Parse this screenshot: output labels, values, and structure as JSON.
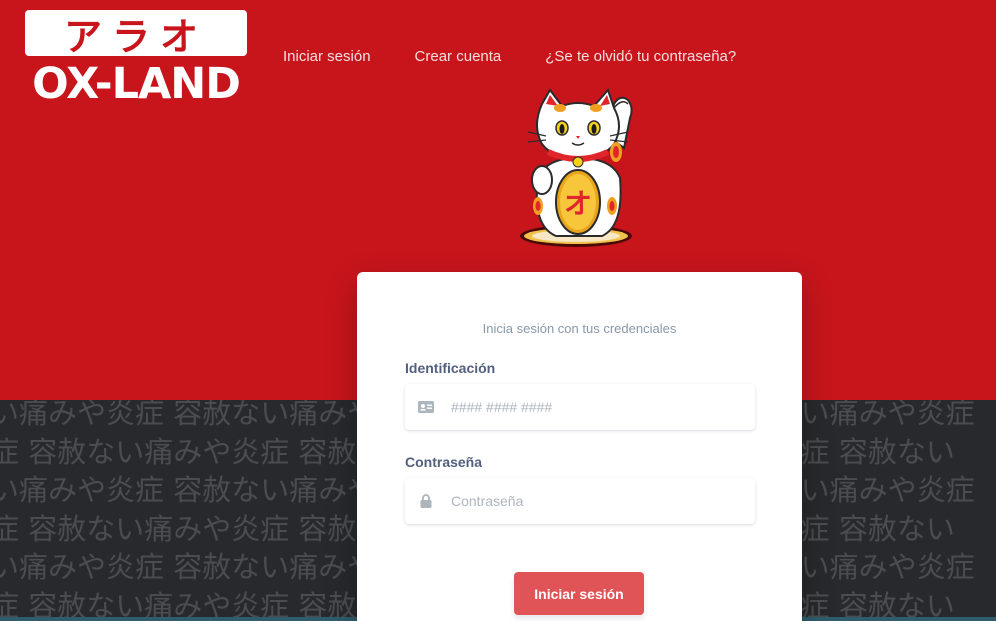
{
  "brand": {
    "logo_kana": "アラオ",
    "logo_word": "OX-LAND"
  },
  "nav": {
    "items": [
      {
        "label": "Iniciar sesión"
      },
      {
        "label": "Crear cuenta"
      },
      {
        "label": "¿Se te olvidó tu contraseña?"
      }
    ]
  },
  "mascot": {
    "coin_char": "オ"
  },
  "login": {
    "subtitle": "Inicia sesión con tus credenciales",
    "id_label": "Identificación",
    "id_placeholder": "#### #### ####",
    "password_label": "Contraseña",
    "password_placeholder": "Contraseña",
    "submit_label": "Iniciar sesión"
  },
  "background_pattern": {
    "rows": [
      "い痛みや炎症 容赦ない痛みや炎症 容赦ない痛みや炎症 容赦ない痛みや炎症",
      "症 容赦ない痛みや炎症 容赦ない痛みや炎症 容赦ない痛みや炎症 容赦ない",
      "い痛みや炎症 容赦ない痛みや炎症 容赦ない痛みや炎症 容赦ない痛みや炎症",
      "症 容赦ない痛みや炎症 容赦ない痛みや炎症 容赦ない痛みや炎症 容赦ない",
      "い痛みや炎症 容赦ない痛みや炎症 容赦ない痛みや炎症 容赦ない痛みや炎症",
      "症 容赦ない痛みや炎症 容赦ない痛みや炎症 容赦ない痛みや炎症 容赦ない"
    ]
  },
  "colors": {
    "brand_red": "#c8151c",
    "dark_bg": "#27292c",
    "button": "#e05458"
  }
}
